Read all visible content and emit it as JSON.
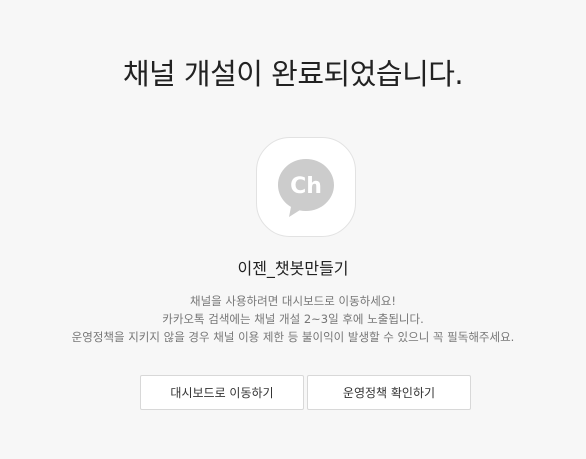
{
  "header": {
    "title": "채널 개설이 완료되었습니다."
  },
  "profile": {
    "icon": "kakao-channel-ch-icon",
    "icon_text": "Ch",
    "icon_color": "#cccccc"
  },
  "channel": {
    "name": "이젠_챗봇만들기"
  },
  "description": {
    "line1": "채널을 사용하려면 대시보드로 이동하세요!",
    "line2": "카카오톡 검색에는 채널 개설 2~3일 후에 노출됩니다.",
    "line3": "운영정책을 지키지 않을 경우 채널 이용 제한 등 불이익이 발생할 수 있으니 꼭 필독해주세요."
  },
  "actions": {
    "dashboard_label": "대시보드로 이동하기",
    "policy_label": "운영정책 확인하기"
  }
}
